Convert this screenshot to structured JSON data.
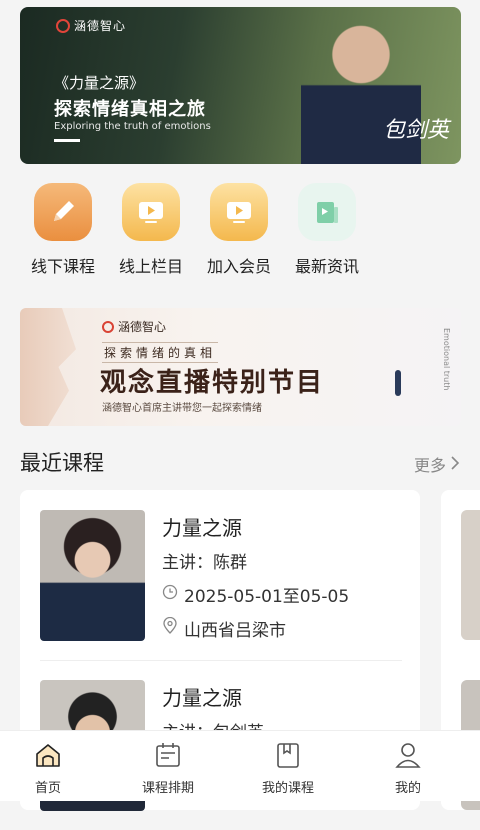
{
  "hero": {
    "brand": "涵德智心",
    "subtitle": "《力量之源》",
    "title": "探索情绪真相之旅",
    "english": "Exploring the truth of emotions",
    "signature": "包剑英"
  },
  "quick_nav": [
    {
      "label": "线下课程",
      "icon": "pencil-icon"
    },
    {
      "label": "线上栏目",
      "icon": "tv-icon"
    },
    {
      "label": "加入会员",
      "icon": "tv-icon"
    },
    {
      "label": "最新资讯",
      "icon": "news-icon"
    }
  ],
  "promo": {
    "brand": "涵德智心",
    "subtitle": "探索情绪的真相",
    "title": "观念直播特别节目",
    "description": "涵德智心首席主讲带您一起探索情绪",
    "vertical": "Emotional truth"
  },
  "recent": {
    "title": "最近课程",
    "more": "更多",
    "courses": [
      {
        "name": "力量之源",
        "teacher": "主讲：陈群",
        "date": "2025-05-01至05-05",
        "location": "山西省吕梁市"
      },
      {
        "name": "力量之源",
        "teacher": "主讲：包剑英"
      }
    ]
  },
  "tabbar": [
    {
      "label": "首页",
      "icon": "home-icon",
      "active": true
    },
    {
      "label": "课程排期",
      "icon": "calendar-icon"
    },
    {
      "label": "我的课程",
      "icon": "book-icon"
    },
    {
      "label": "我的",
      "icon": "profile-icon"
    }
  ],
  "colors": {
    "accent": "#ea8f3f",
    "brand_red": "#e2453a"
  }
}
